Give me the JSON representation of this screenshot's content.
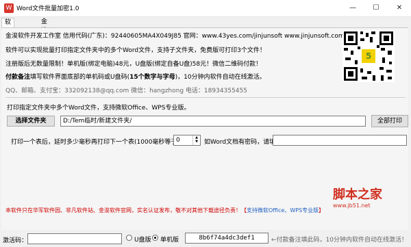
{
  "window": {
    "title": "Word文件批量加密1.0",
    "minimize_glyph": "—",
    "maximize_glyph": "☐",
    "close_glyph": "✕"
  },
  "tabs": [
    {
      "label": "软件设置"
    },
    {
      "label": "金浚软件"
    }
  ],
  "info": {
    "company_line": "金浚软件开发工作室 信用代码(广东)：92440605MA4X049J85 官网：www.43yes.com/jinjunsoft  www.jinjunsoft.com(在建)",
    "intro": "软件可以实现批量打印指定文件夹中的多个Word文件，支持子文件夹，免费版可打印3个文件！",
    "price": "注册版后无数量限制！单机版(绑定电脑)48元，U盘版(绑定自备U盘)58元！微信二维码付款！",
    "payment_bold": "付款备注",
    "payment_rest": "填写软件界面底部的单机码或U盘码(",
    "payment_bold2": "15个数字与字母",
    "payment_end": ")，10分钟内软件自动在线激活。",
    "contact": "QQ、邮箱、支付宝：332092138@qq.com     微信：hangzhong    电话：18934355455"
  },
  "qr": {
    "logo": "5"
  },
  "print_section": {
    "heading": "打印指定文件夹中多个Word文件，支持微软Office、WPS专业版。",
    "select_folder_button": "选择文件夹",
    "folder_path": "D:/Tem临时/新建文件夹/",
    "print_all_button": "全部打印",
    "delay_label": "打印一个表后，延时多少毫秒再打印下一个表(1000毫秒等于1秒)：",
    "delay_value": "0",
    "password_label": "如Word文档有密码，请填写：",
    "password_value": ""
  },
  "notice": {
    "text": "本软件只在华军软件园、非凡软件站、金浚软件官网，实名认证发布，敬不对其他下载途径负责！【",
    "highlight": "支持微软Office、WPS专业版",
    "end": "】"
  },
  "watermark": {
    "text": "脚本之家",
    "url": "www.jb51.net"
  },
  "statusbar": {
    "code_label": "激活码：",
    "code_value": "",
    "radio_usb": "U盘版",
    "radio_pc": "单机版",
    "machine_code": "8b6f74a4dc3def1",
    "hint": "←付款备注填此码，10分钟内软件自动在线激活！"
  },
  "colors": {
    "notice_red": "#d00000",
    "watermark_red": "#d03020",
    "app_icon_red": "#d6362e"
  }
}
